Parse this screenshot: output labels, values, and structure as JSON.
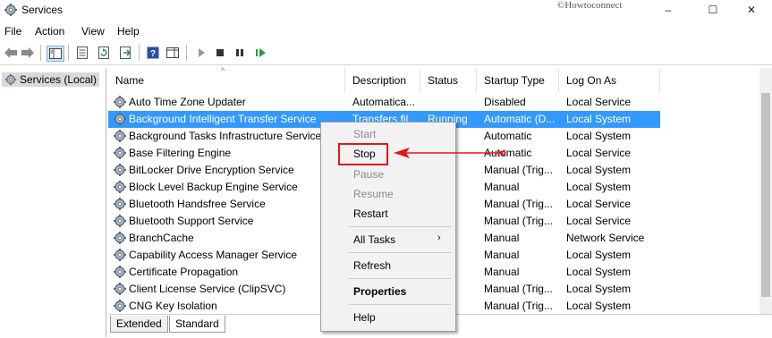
{
  "window": {
    "title": "Services",
    "watermark": "©Howtoconnect",
    "minimize": "–",
    "maximize": "☐",
    "close": "✕"
  },
  "menu": [
    "File",
    "Action",
    "View",
    "Help"
  ],
  "tree": {
    "root": "Services (Local)"
  },
  "columns": [
    "Name",
    "Description",
    "Status",
    "Startup Type",
    "Log On As"
  ],
  "services": [
    {
      "name": "Auto Time Zone Updater",
      "description": "Automatica...",
      "status": "",
      "startup": "Disabled",
      "logon": "Local Service"
    },
    {
      "name": "Background Intelligent Transfer Service",
      "description": "Transfers fil...",
      "status": "Running",
      "startup": "Automatic (D...",
      "logon": "Local System",
      "selected": true
    },
    {
      "name": "Background Tasks Infrastructure Service",
      "description": "",
      "status": "ing",
      "startup": "Automatic",
      "logon": "Local System"
    },
    {
      "name": "Base Filtering Engine",
      "description": "",
      "status": "ing",
      "startup": "Automatic",
      "logon": "Local Service"
    },
    {
      "name": "BitLocker Drive Encryption Service",
      "description": "",
      "status": "",
      "startup": "Manual (Trig...",
      "logon": "Local System"
    },
    {
      "name": "Block Level Backup Engine Service",
      "description": "",
      "status": "",
      "startup": "Manual",
      "logon": "Local System"
    },
    {
      "name": "Bluetooth Handsfree Service",
      "description": "",
      "status": "",
      "startup": "Manual (Trig...",
      "logon": "Local Service"
    },
    {
      "name": "Bluetooth Support Service",
      "description": "",
      "status": "ing",
      "startup": "Manual (Trig...",
      "logon": "Local Service"
    },
    {
      "name": "BranchCache",
      "description": "",
      "status": "",
      "startup": "Manual",
      "logon": "Network Service"
    },
    {
      "name": "Capability Access Manager Service",
      "description": "",
      "status": "",
      "startup": "Manual",
      "logon": "Local System"
    },
    {
      "name": "Certificate Propagation",
      "description": "",
      "status": "",
      "startup": "Manual",
      "logon": "Local System"
    },
    {
      "name": "Client License Service (ClipSVC)",
      "description": "",
      "status": "",
      "startup": "Manual (Trig...",
      "logon": "Local System"
    },
    {
      "name": "CNG Key Isolation",
      "description": "",
      "status": "ing",
      "startup": "Manual (Trig...",
      "logon": "Local System"
    }
  ],
  "context_menu": {
    "start": "Start",
    "stop": "Stop",
    "pause": "Pause",
    "resume": "Resume",
    "restart": "Restart",
    "all_tasks": "All Tasks",
    "refresh": "Refresh",
    "properties": "Properties",
    "help": "Help",
    "submenu_arrow": "›"
  },
  "tabs": [
    "Extended",
    "Standard"
  ],
  "colors": {
    "selection": "#3399ff",
    "annotation": "#e0181c"
  }
}
